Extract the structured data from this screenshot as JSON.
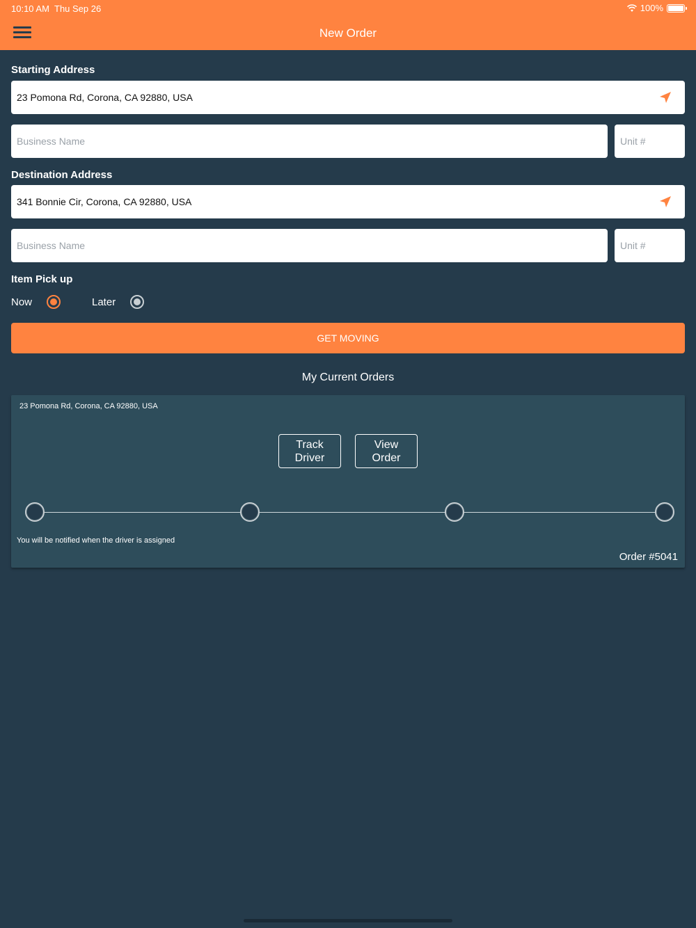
{
  "status_bar": {
    "time": "10:10 AM",
    "date": "Thu Sep 26",
    "battery": "100%"
  },
  "nav": {
    "title": "New Order",
    "menu_icon": "hamburger-menu-icon"
  },
  "starting": {
    "label": "Starting Address",
    "address_value": "23 Pomona Rd, Corona, CA 92880, USA",
    "business_placeholder": "Business Name",
    "unit_placeholder": "Unit #",
    "location_icon": "location-arrow-icon"
  },
  "destination": {
    "label": "Destination Address",
    "address_value": "341 Bonnie Cir, Corona, CA 92880, USA",
    "business_placeholder": "Business Name",
    "unit_placeholder": "Unit #",
    "location_icon": "location-arrow-icon"
  },
  "pickup": {
    "label": "Item Pick up",
    "options": [
      {
        "label": "Now",
        "selected": true
      },
      {
        "label": "Later",
        "selected": false
      }
    ]
  },
  "cta": {
    "label": "GET MOVING"
  },
  "orders_section": {
    "title": "My Current Orders"
  },
  "order_card": {
    "address": "23 Pomona Rd, Corona, CA 92880, USA",
    "track_button": {
      "line1": "Track",
      "line2": "Driver"
    },
    "view_button": {
      "line1": "View",
      "line2": "Order"
    },
    "steps_total": 4,
    "note": "You will be notified when the driver is assigned",
    "order_number": "Order #5041"
  },
  "colors": {
    "accent": "#ff8340",
    "background": "#253b4b",
    "card": "#2e4d5b",
    "radio_selected": "#ff8340",
    "radio_unselected": "#c8cfd3"
  }
}
